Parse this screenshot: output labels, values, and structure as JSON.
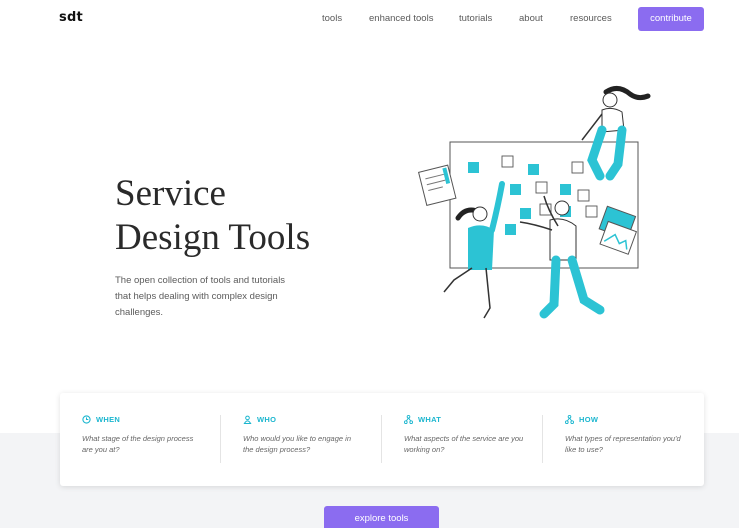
{
  "header": {
    "logo": "sdt",
    "nav": [
      "tools",
      "enhanced tools",
      "tutorials",
      "about",
      "resources"
    ],
    "contribute_label": "contribute"
  },
  "hero": {
    "title_line1": "Service",
    "title_line2": "Design Tools",
    "subtitle_line1": "The open collection of tools and tutorials",
    "subtitle_line2": "that helps dealing with complex design",
    "subtitle_line3": "challenges."
  },
  "filters": [
    {
      "icon": "clock-icon",
      "label": "WHEN",
      "question": "What stage of the design process are you at?"
    },
    {
      "icon": "user-icon",
      "label": "WHO",
      "question": "Who would you like to engage in the design process?"
    },
    {
      "icon": "network-icon",
      "label": "WHAT",
      "question": "What aspects of the service are you working on?"
    },
    {
      "icon": "network-icon",
      "label": "HOW",
      "question": "What types of representation you'd like to use?"
    }
  ],
  "explore_label": "explore tools",
  "colors": {
    "accent": "#8b6cf0",
    "teal": "#1bb6cf",
    "illustration": "#2cc3d4"
  }
}
